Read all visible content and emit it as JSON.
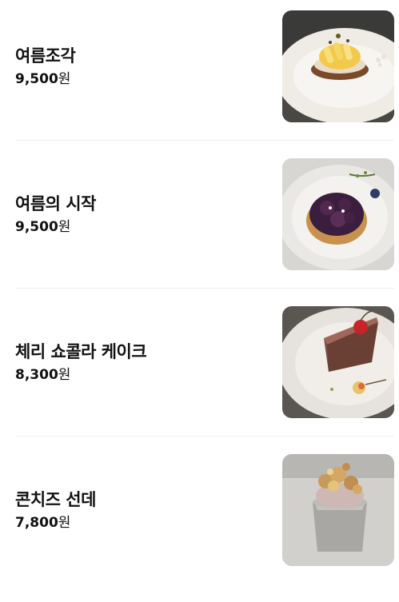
{
  "menu": {
    "items": [
      {
        "name": "여름조각",
        "price": "9,500",
        "currency": "원",
        "image": "cake-photo-yellow-fruit-tart"
      },
      {
        "name": "여름의 시작",
        "price": "9,500",
        "currency": "원",
        "image": "cake-photo-blueberry-tart"
      },
      {
        "name": "체리 쇼콜라 케이크",
        "price": "8,300",
        "currency": "원",
        "image": "cake-photo-chocolate-cherry-slice"
      },
      {
        "name": "콘치즈 선데",
        "price": "7,800",
        "currency": "원",
        "image": "cake-photo-corn-cheese-sundae"
      }
    ]
  }
}
